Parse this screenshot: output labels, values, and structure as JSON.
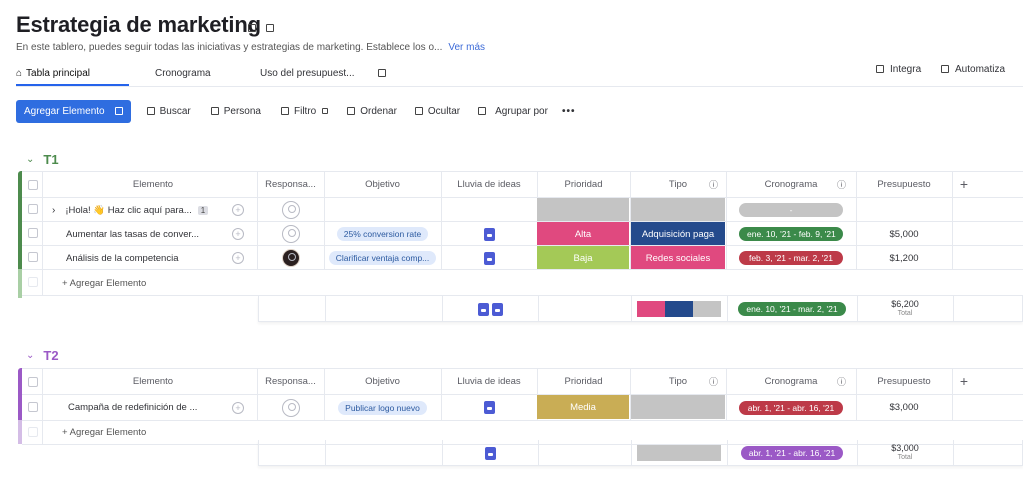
{
  "board": {
    "title": "Estrategia de marketing",
    "description": "En este tablero, puedes seguir todas las iniciativas y estrategias de marketing. Establece los o...",
    "more_link": "Ver más"
  },
  "tabs": [
    {
      "label": "Tabla principal",
      "active": true,
      "icon": "home-icon"
    },
    {
      "label": "Cronograma"
    },
    {
      "label": "Uso del presupuest..."
    }
  ],
  "right_actions": {
    "integrate": "Integra",
    "automate": "Automatiza"
  },
  "toolbar": {
    "add_label": "Agregar Elemento",
    "search": "Buscar",
    "person": "Persona",
    "filter": "Filtro",
    "sort": "Ordenar",
    "hide": "Ocultar",
    "group_by": "Agrupar por",
    "more": "•••"
  },
  "columns": {
    "item": "Elemento",
    "owner": "Responsa...",
    "objective": "Objetivo",
    "ideas": "Lluvia de ideas",
    "priority": "Prioridad",
    "type": "Tipo",
    "timeline": "Cronograma",
    "budget": "Presupuesto",
    "add": "+"
  },
  "colors": {
    "accent": "#2f6de0",
    "t1": "#4d8b4d",
    "t2": "#9b59c6",
    "alta": "#e0497f",
    "baja": "#a4c957",
    "media": "#c9ad55",
    "adquisicion": "#244a8c",
    "redes": "#e0497f",
    "empty": "#c4c4c4",
    "tl_green": "#3b8a4a",
    "tl_red": "#bd3a48",
    "tl_purple": "#9b59c6"
  },
  "groups": [
    {
      "name": "T1",
      "add_item": "+ Agregar Elemento",
      "rows": [
        {
          "item": "¡Hola! 👋 Haz clic aquí para...",
          "badge": "1",
          "objective": "",
          "ideas": false,
          "priority": "",
          "type": "",
          "timeline": "-",
          "budget": ""
        },
        {
          "item": "Aumentar las tasas de conver...",
          "objective": "25% conversion rate",
          "ideas": true,
          "priority": "Alta",
          "type": "Adquisición paga",
          "timeline": "ene. 10, '21 - feb. 9, '21",
          "budget": "$5,000"
        },
        {
          "item": "Análisis de la competencia",
          "objective": "Clarificar ventaja comp...",
          "ideas": true,
          "priority": "Baja",
          "type": "Redes sociales",
          "timeline": "feb. 3, '21 - mar. 2, '21",
          "budget": "$1,200"
        }
      ],
      "summary": {
        "timeline": "ene. 10, '21 - mar. 2, '21",
        "budget": "$6,200",
        "budget_label": "Total"
      }
    },
    {
      "name": "T2",
      "add_item": "+ Agregar Elemento",
      "rows": [
        {
          "item": "Campaña de redefinición de ...",
          "objective": "Publicar logo nuevo",
          "ideas": true,
          "priority": "Media",
          "type": "",
          "timeline": "abr. 1, '21 - abr. 16, '21",
          "budget": "$3,000"
        }
      ],
      "summary": {
        "timeline": "abr. 1, '21 - abr. 16, '21",
        "budget": "$3,000",
        "budget_label": "Total"
      }
    }
  ]
}
